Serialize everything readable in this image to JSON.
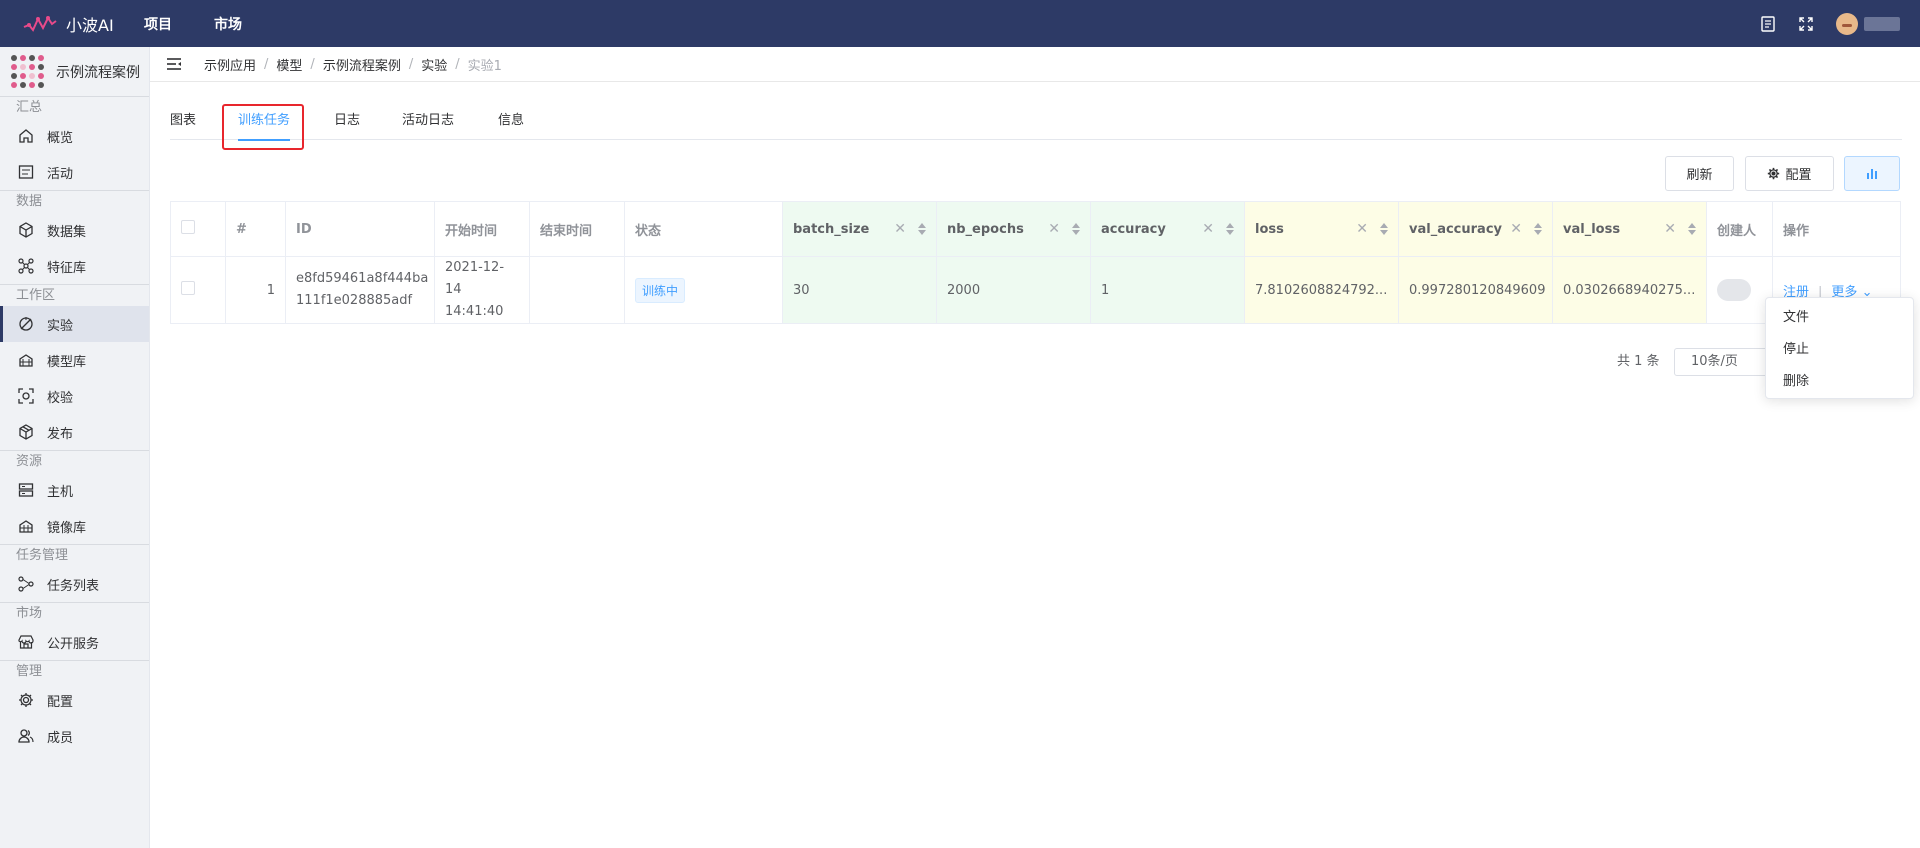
{
  "app": {
    "name": "小波AI"
  },
  "topnav": [
    "项目",
    "市场"
  ],
  "sidebar": {
    "project_name": "示例流程案例",
    "sections": [
      {
        "title": "汇总",
        "items": [
          {
            "label": "概览",
            "icon": "home-icon"
          },
          {
            "label": "活动",
            "icon": "activity-icon"
          }
        ]
      },
      {
        "title": "数据",
        "items": [
          {
            "label": "数据集",
            "icon": "dataset-icon"
          },
          {
            "label": "特征库",
            "icon": "feature-icon"
          }
        ]
      },
      {
        "title": "工作区",
        "items": [
          {
            "label": "实验",
            "icon": "experiment-icon",
            "active": true
          },
          {
            "label": "模型库",
            "icon": "model-icon"
          },
          {
            "label": "校验",
            "icon": "validate-icon"
          },
          {
            "label": "发布",
            "icon": "publish-icon"
          }
        ]
      },
      {
        "title": "资源",
        "items": [
          {
            "label": "主机",
            "icon": "server-icon"
          },
          {
            "label": "镜像库",
            "icon": "image-repo-icon"
          }
        ]
      },
      {
        "title": "任务管理",
        "items": [
          {
            "label": "任务列表",
            "icon": "task-icon"
          }
        ]
      },
      {
        "title": "市场",
        "items": [
          {
            "label": "公开服务",
            "icon": "store-icon"
          }
        ]
      },
      {
        "title": "管理",
        "items": [
          {
            "label": "配置",
            "icon": "gear-icon"
          },
          {
            "label": "成员",
            "icon": "members-icon"
          }
        ]
      }
    ]
  },
  "breadcrumb": [
    "示例应用",
    "模型",
    "示例流程案例",
    "实验",
    "实验1"
  ],
  "tabs": [
    "图表",
    "训练任务",
    "日志",
    "活动日志",
    "信息"
  ],
  "active_tab": "训练任务",
  "toolbar": {
    "refresh": "刷新",
    "config": "配置"
  },
  "table": {
    "columns": [
      "#",
      "ID",
      "开始时间",
      "结束时间",
      "状态",
      "batch_size",
      "nb_epochs",
      "accuracy",
      "loss",
      "val_accuracy",
      "val_loss",
      "创建人",
      "操作"
    ],
    "rows": [
      {
        "index": "1",
        "id": "e8fd59461a8f444ba111f1e028885adf",
        "id_line1": "e8fd59461a8f444ba",
        "id_line2": "111f1e028885adf",
        "start_date": "2021-12-14",
        "start_time": "14:41:40",
        "end_time": "",
        "status": "训练中",
        "batch_size": "30",
        "nb_epochs": "2000",
        "accuracy": "1",
        "loss": "7.8102608824792...",
        "val_accuracy": "0.997280120849609",
        "val_loss": "0.0302668940275...",
        "op_register": "注册",
        "op_more": "更多"
      }
    ]
  },
  "pagination": {
    "total": "共 1 条",
    "page_size": "10条/页"
  },
  "dropdown": [
    "文件",
    "停止",
    "删除"
  ],
  "colors": {
    "topbar": "#2d3a66",
    "accent": "#409eff",
    "highlight": "#e8262d",
    "metric_green": "#eefaf1",
    "metric_yellow": "#fdfde6"
  }
}
